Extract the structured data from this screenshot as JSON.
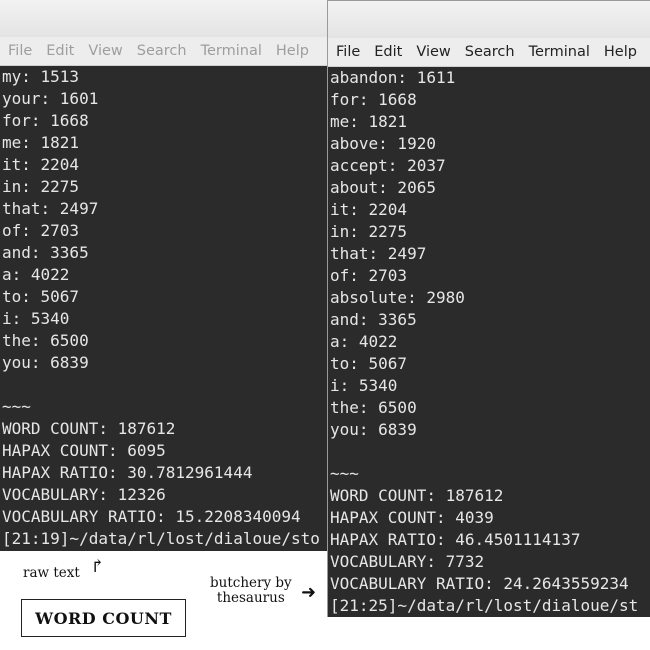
{
  "left_terminal": {
    "menu": [
      "File",
      "Edit",
      "View",
      "Search",
      "Terminal",
      "Help"
    ],
    "lines": [
      "my: 1513",
      "your: 1601",
      "for: 1668",
      "me: 1821",
      "it: 2204",
      "in: 2275",
      "that: 2497",
      "of: 2703",
      "and: 3365",
      "a: 4022",
      "to: 5067",
      "i: 5340",
      "the: 6500",
      "you: 6839",
      "",
      "~~~",
      "WORD COUNT: 187612",
      "HAPAX COUNT: 6095",
      "HAPAX RATIO: 30.7812961444",
      "VOCABULARY: 12326",
      "VOCABULARY RATIO: 15.2208340094",
      "[21:19]~/data/rl/lost/dialoue/sto"
    ]
  },
  "right_terminal": {
    "menu": [
      "File",
      "Edit",
      "View",
      "Search",
      "Terminal",
      "Help"
    ],
    "lines": [
      "abandon: 1611",
      "for: 1668",
      "me: 1821",
      "above: 1920",
      "accept: 2037",
      "about: 2065",
      "it: 2204",
      "in: 2275",
      "that: 2497",
      "of: 2703",
      "absolute: 2980",
      "and: 3365",
      "a: 4022",
      "to: 5067",
      "i: 5340",
      "the: 6500",
      "you: 6839",
      "",
      "~~~",
      "WORD COUNT: 187612",
      "HAPAX COUNT: 4039",
      "HAPAX RATIO: 46.4501114137",
      "VOCABULARY: 7732",
      "VOCABULARY RATIO: 24.2643559234",
      "[21:25]~/data/rl/lost/dialoue/st"
    ]
  },
  "annotations": {
    "raw_text": "raw text",
    "raw_arrow": "↱",
    "butchery_line1": "butchery by",
    "butchery_line2": "thesaurus",
    "butchery_arrow": "➜",
    "word_count_box": "WORD COUNT"
  }
}
